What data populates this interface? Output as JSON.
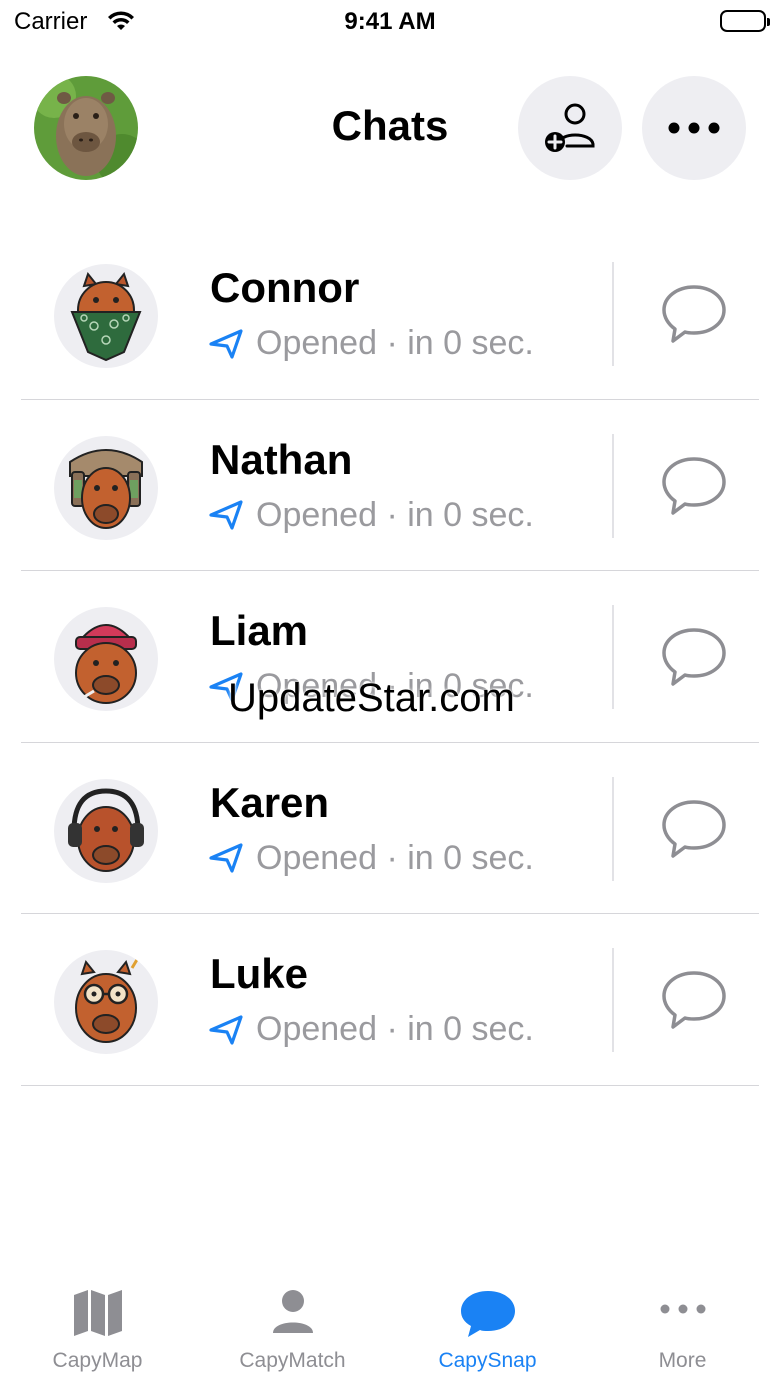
{
  "status_bar": {
    "carrier": "Carrier",
    "time": "9:41 AM"
  },
  "header": {
    "title": "Chats",
    "profile_icon": "capybara-photo-avatar",
    "add_friend_icon": "person-add-icon",
    "more_icon": "ellipsis-icon"
  },
  "chats": [
    {
      "name": "Connor",
      "status": "Opened · in 0 sec.",
      "avatar": "capybara-bandana-avatar"
    },
    {
      "name": "Nathan",
      "status": "Opened · in 0 sec.",
      "avatar": "capybara-ushanka-avatar"
    },
    {
      "name": "Liam",
      "status": "Opened · in 0 sec.",
      "avatar": "capybara-beanie-avatar"
    },
    {
      "name": "Karen",
      "status": "Opened · in 0 sec.",
      "avatar": "capybara-headphones-avatar"
    },
    {
      "name": "Luke",
      "status": "Opened · in 0 sec.",
      "avatar": "capybara-glasses-avatar"
    }
  ],
  "watermark": "UpdateStar.com",
  "tabs": [
    {
      "label": "CapyMap",
      "icon": "map-icon",
      "active": false
    },
    {
      "label": "CapyMatch",
      "icon": "person-icon",
      "active": false
    },
    {
      "label": "CapySnap",
      "icon": "chat-bubble-icon",
      "active": true
    },
    {
      "label": "More",
      "icon": "ellipsis-icon",
      "active": false
    }
  ],
  "colors": {
    "accent": "#1a82f4",
    "secondary_text": "#9a9a9e",
    "button_bg": "#eeeef2",
    "divider": "#d6d6da",
    "tab_inactive": "#8e8e93"
  }
}
